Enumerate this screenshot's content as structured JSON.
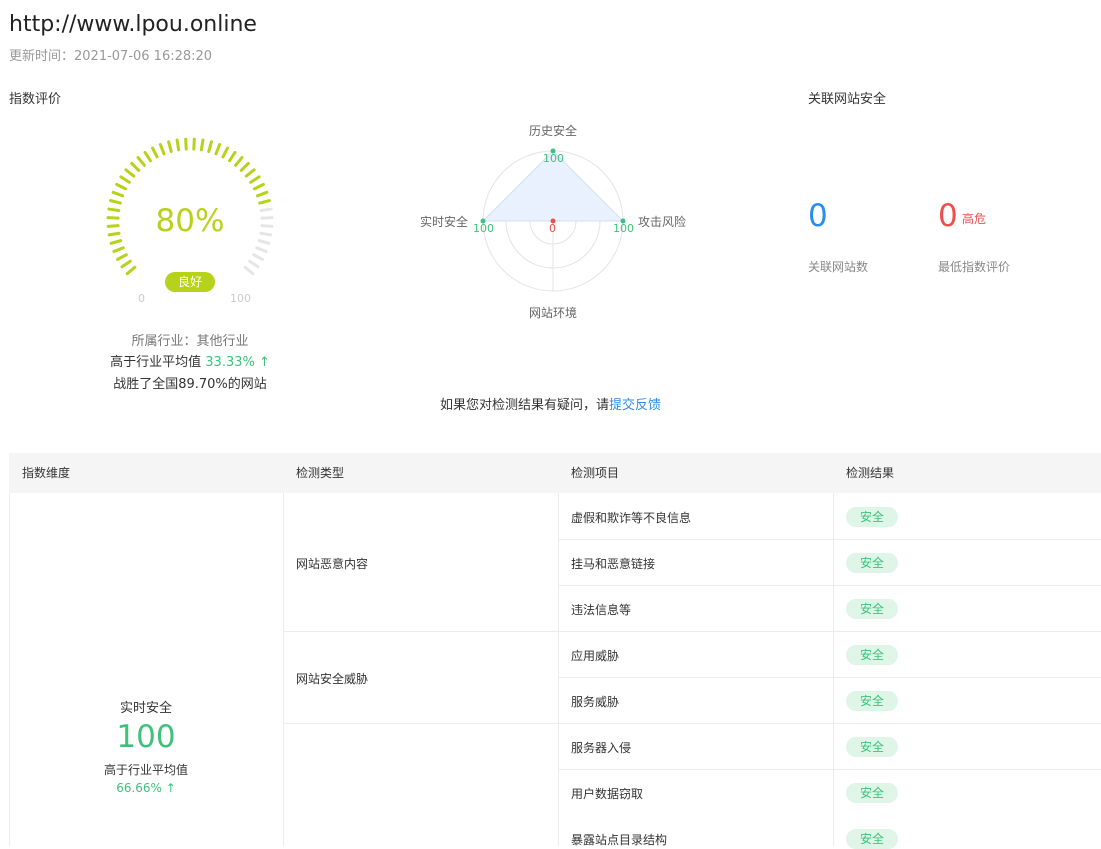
{
  "header": {
    "url": "http://www.lpou.online",
    "update_time": "更新时间：2021-07-06 16:28:20"
  },
  "score_section": {
    "title": "指数评价",
    "value": "80%",
    "score_fraction": 0.8,
    "badge": "良好",
    "min": "0",
    "max": "100",
    "industry": "所属行业：其他行业",
    "above_avg_prefix": "高于行业平均值",
    "above_avg_value": "33.33% ↑",
    "beat_text": "战胜了全国89.70%的网站",
    "colors": {
      "accent": "#b6d21a",
      "track": "#e6e6e6",
      "positive": "#3ec27a"
    }
  },
  "radar": {
    "axes": [
      {
        "label": "历史安全",
        "value": "100"
      },
      {
        "label": "攻击风险",
        "value": "100"
      },
      {
        "label": "网站环境",
        "value": "0"
      },
      {
        "label": "实时安全",
        "value": "100"
      }
    ],
    "colors": {
      "fill": "#e8f1fd",
      "point_good": "#3ec27a",
      "point_bad": "#ed4e4e"
    }
  },
  "linked": {
    "title": "关联网站安全",
    "count": "0",
    "count_label": "关联网站数",
    "lowest": "0",
    "lowest_tag": "高危",
    "lowest_label": "最低指数评价",
    "colors": {
      "count": "#2d8cf0",
      "lowest": "#ed4e4e"
    }
  },
  "feedback": {
    "text": "如果您对检测结果有疑问，请",
    "link": "提交反馈"
  },
  "table": {
    "headers": [
      "指数维度",
      "检测类型",
      "检测项目",
      "检测结果"
    ],
    "dimension": {
      "name": "实时安全",
      "score": "100",
      "above_text": "高于行业平均值",
      "above_value": "66.66% ↑"
    },
    "types": [
      "网站恶意内容",
      "网站安全威胁"
    ],
    "items": [
      {
        "name": "虚假和欺诈等不良信息",
        "result": "安全"
      },
      {
        "name": "挂马和恶意链接",
        "result": "安全"
      },
      {
        "name": "违法信息等",
        "result": "安全"
      },
      {
        "name": "应用威胁",
        "result": "安全"
      },
      {
        "name": "服务威胁",
        "result": "安全"
      },
      {
        "name": "服务器入侵",
        "result": "安全"
      },
      {
        "name": "用户数据窃取",
        "result": "安全"
      },
      {
        "name": "暴露站点目录结构",
        "result": "安全"
      }
    ]
  }
}
